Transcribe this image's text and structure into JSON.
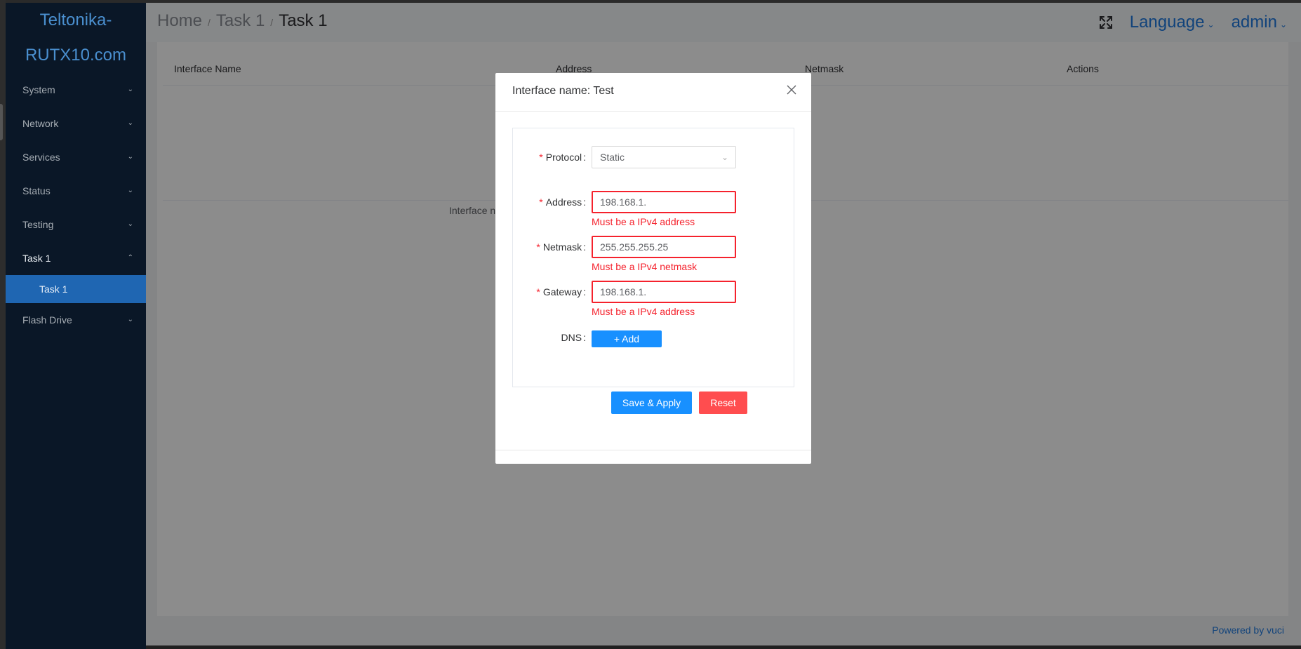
{
  "brand": {
    "line1": "Teltonika-",
    "line2": "RUTX10.com"
  },
  "sidebar": {
    "items": [
      {
        "label": "System",
        "chevron": "chevron-down-icon"
      },
      {
        "label": "Network",
        "chevron": "chevron-down-icon"
      },
      {
        "label": "Services",
        "chevron": "chevron-down-icon"
      },
      {
        "label": "Status",
        "chevron": "chevron-down-icon"
      },
      {
        "label": "Testing",
        "chevron": "chevron-down-icon"
      },
      {
        "label": "Task 1",
        "chevron": "chevron-up-icon"
      },
      {
        "label": "Flash Drive",
        "chevron": "chevron-down-icon"
      }
    ],
    "sub_item": "Task 1"
  },
  "header": {
    "breadcrumb": [
      "Home",
      "Task 1",
      "Task 1"
    ],
    "separator": "/",
    "language": "Language",
    "user": "admin"
  },
  "table": {
    "columns": [
      "Interface Name",
      "Address",
      "Netmask",
      "Actions"
    ],
    "partial_label": "Interface nar"
  },
  "footer": {
    "text": "Powered by vuci"
  },
  "dialog": {
    "title": "Interface name: Test",
    "protocol": {
      "label": "Protocol",
      "value": "Static"
    },
    "address": {
      "label": "Address",
      "value": "198.168.1.",
      "error": "Must be a IPv4 address"
    },
    "netmask": {
      "label": "Netmask",
      "value": "255.255.255.25",
      "error": "Must be a IPv4 netmask"
    },
    "gateway": {
      "label": "Gateway",
      "value": "198.168.1.",
      "error": "Must be a IPv4 address"
    },
    "dns": {
      "label": "DNS",
      "add_label": "+ Add"
    },
    "save_label": "Save & Apply",
    "reset_label": "Reset"
  },
  "colors": {
    "sidebar_bg": "#0a1727",
    "active_item": "#1f66b2",
    "primary": "#1890ff",
    "danger": "#f5222d",
    "reset": "#ff4d4f"
  }
}
